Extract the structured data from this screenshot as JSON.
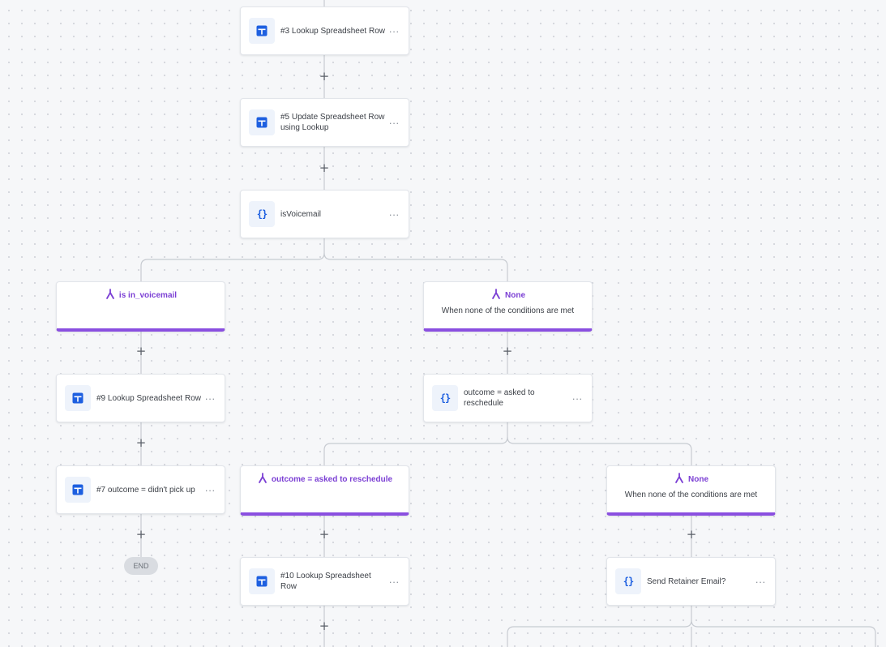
{
  "canvas": {
    "nodes": [
      {
        "id": "n3",
        "icon": "spreadsheet-icon",
        "label": "#3 Lookup Spreadsheet Row"
      },
      {
        "id": "n5",
        "icon": "spreadsheet-icon",
        "label": "#5 Update Spreadsheet Row using Lookup"
      },
      {
        "id": "isv",
        "icon": "code-icon",
        "icon_text": "{}",
        "label": "isVoicemail"
      },
      {
        "id": "n9",
        "icon": "spreadsheet-icon",
        "label": "#9 Lookup Spreadsheet Row"
      },
      {
        "id": "n7",
        "icon": "spreadsheet-icon",
        "label": "#7 outcome = didn't pick up"
      },
      {
        "id": "out",
        "icon": "code-icon",
        "icon_text": "{}",
        "label": "outcome = asked to reschedule"
      },
      {
        "id": "n10",
        "icon": "spreadsheet-icon",
        "label": "#10 Lookup Spreadsheet Row"
      },
      {
        "id": "send",
        "icon": "code-icon",
        "icon_text": "{}",
        "label": "Send Retainer Email?"
      }
    ],
    "branches": [
      {
        "id": "b_vm",
        "icon": "branch-icon",
        "title": "is in_voicemail",
        "subtitle": ""
      },
      {
        "id": "b_none1",
        "icon": "branch-icon",
        "title": "None",
        "subtitle": "When none of the conditions are met"
      },
      {
        "id": "b_resched",
        "icon": "branch-icon",
        "title": "outcome = asked to reschedule",
        "subtitle": ""
      },
      {
        "id": "b_none2",
        "icon": "branch-icon",
        "title": "None",
        "subtitle": "When none of the conditions are met"
      }
    ],
    "menu_glyph": "···",
    "plus_glyph": "+",
    "end_label": "END"
  },
  "colors": {
    "background": "#f6f7f9",
    "accent_purple": "#8a4fe0",
    "branch_text": "#7b3fd4",
    "icon_blue": "#1d5fe0",
    "connector": "#c7cbd1"
  }
}
